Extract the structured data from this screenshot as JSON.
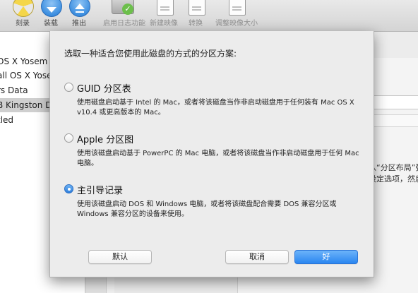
{
  "toolbar": {
    "items": [
      {
        "label": "刻录",
        "icon": "burn-icon"
      },
      {
        "label": "装载",
        "icon": "mount-icon"
      },
      {
        "label": "推出",
        "icon": "eject-icon"
      },
      {
        "label": "启用日志功能",
        "icon": "journal-icon"
      },
      {
        "label": "新建映像",
        "icon": "new-image-icon"
      },
      {
        "label": "转换",
        "icon": "convert-icon"
      },
      {
        "label": "调整映像大小",
        "icon": "resize-image-icon"
      }
    ]
  },
  "sidebar": {
    "items": [
      {
        "label": "OS X Yosem"
      },
      {
        "label": "all OS X Yose"
      },
      {
        "label": "rs Data"
      },
      {
        "label": "B Kingston D"
      },
      {
        "label": "tled"
      }
    ]
  },
  "right_pane": {
    "line1": "从“分区布局”弹",
    "line2": "设定选项，然后",
    "field_hint": ")"
  },
  "dialog": {
    "title": "选取一种适合您使用此磁盘的方式的分区方案:",
    "options": [
      {
        "label": "GUID 分区表",
        "description": "使用磁盘启动基于 Intel 的 Mac，或者将该磁盘当作非启动磁盘用于任何装有 Mac OS X v10.4 或更高版本的 Mac。",
        "checked": false
      },
      {
        "label": "Apple 分区图",
        "description": "使用该磁盘启动基于 PowerPC 的 Mac 电脑，或者将该磁盘当作非启动磁盘用于任何 Mac 电脑。",
        "checked": false
      },
      {
        "label": "主引导记录",
        "description": "使用该磁盘启动 DOS 和 Windows 电脑，或者将该磁盘配合需要 DOS 兼容分区或 Windows 兼容分区的设备来使用。",
        "checked": true
      }
    ],
    "buttons": {
      "default": "默认",
      "cancel": "取消",
      "ok": "好"
    }
  },
  "colors": {
    "accent": "#2a86f0",
    "window_bg": "#ececec"
  }
}
